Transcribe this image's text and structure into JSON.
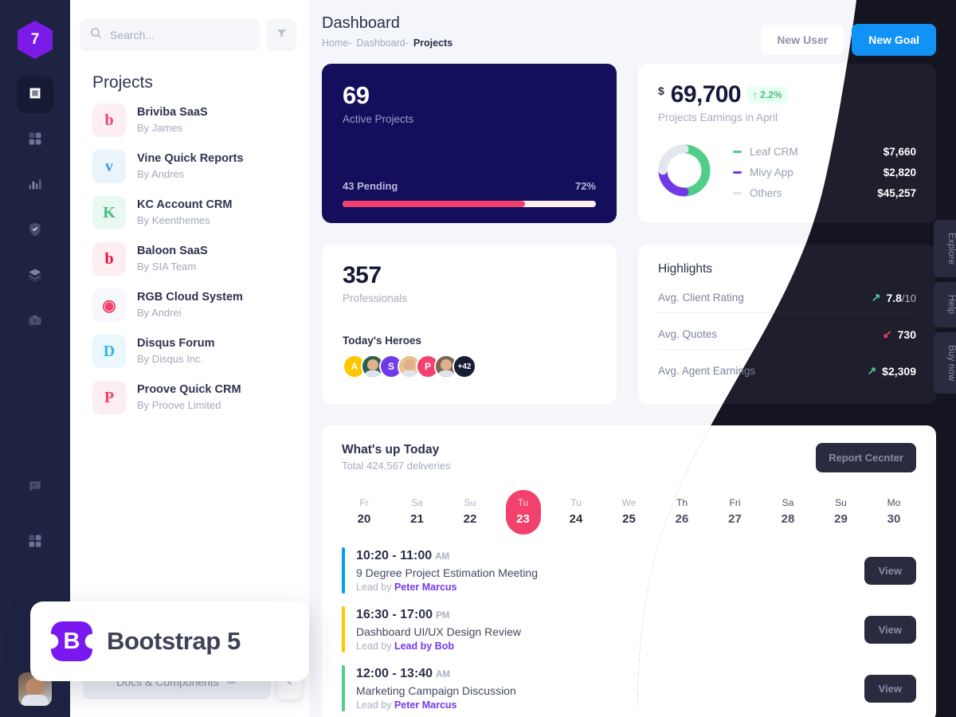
{
  "rail": {
    "logo_text": "7",
    "items": [
      {
        "name": "artboard-icon",
        "active": true
      },
      {
        "name": "grid-icon",
        "active": false
      },
      {
        "name": "bar-chart-icon",
        "active": false
      },
      {
        "name": "shield-check-icon",
        "active": false
      },
      {
        "name": "layers-icon",
        "active": false
      },
      {
        "name": "briefcase-icon",
        "active": false
      }
    ],
    "bottom_items": [
      {
        "name": "chat-icon"
      },
      {
        "name": "grid-icon"
      }
    ]
  },
  "search": {
    "placeholder": "Search...",
    "value": "",
    "icon": "search-icon",
    "filter_icon": "filter-icon"
  },
  "panel": {
    "title": "Projects",
    "docs_label": "Docs & Components",
    "projects": [
      {
        "name": "Briviba SaaS",
        "by": "By James",
        "glyph": "b",
        "color": "#f1416c",
        "bg": "#fdeef2"
      },
      {
        "name": "Vine Quick Reports",
        "by": "By Andres",
        "glyph": "v",
        "color": "#3b9ae1",
        "bg": "#eaf4fc"
      },
      {
        "name": "KC Account CRM",
        "by": "By Keenthemes",
        "glyph": "K",
        "color": "#47be7d",
        "bg": "#e9f8f0"
      },
      {
        "name": "Baloon SaaS",
        "by": "By SIA Team",
        "glyph": "b",
        "color": "#e8113c",
        "bg": "#fdeef2"
      },
      {
        "name": "RGB Cloud System",
        "by": "By Andrei",
        "glyph": "◉",
        "color": "#f1416c",
        "bg": "#f6f8fb"
      },
      {
        "name": "Disqus Forum",
        "by": "By Disqus Inc.",
        "glyph": "D",
        "color": "#2fb9e8",
        "bg": "#eaf7fd"
      },
      {
        "name": "Proove Quick CRM",
        "by": "By Proove Limited",
        "glyph": "P",
        "color": "#f1416c",
        "bg": "#fdeef2"
      }
    ]
  },
  "header": {
    "title": "Dashboard",
    "breadcrumb": [
      {
        "label": "Home-",
        "current": false
      },
      {
        "label": "Dashboard-",
        "current": false
      },
      {
        "label": "Projects",
        "current": true
      }
    ],
    "new_user_label": "New User",
    "new_goal_label": "New Goal"
  },
  "active_projects": {
    "count": "69",
    "label": "Active Projects",
    "pending": "43 Pending",
    "percent_label": "72%",
    "percent": 72,
    "bar_color": "#f1416c"
  },
  "earnings": {
    "currency": "$",
    "amount": "69,700",
    "delta": "2.2%",
    "delta_arrow": "↑",
    "subtitle": "Projects Earnings in April",
    "legend": [
      {
        "label": "Leaf CRM",
        "value": "$7,660",
        "color": "#50cd89"
      },
      {
        "label": "Mivy App",
        "value": "$2,820",
        "color": "#7239ea"
      },
      {
        "label": "Others",
        "value": "$45,257",
        "color": "#dfe2ea"
      }
    ],
    "donut": [
      {
        "name": "Leaf CRM",
        "pct": 50,
        "color": "#50cd89"
      },
      {
        "name": "Mivy App",
        "pct": 25,
        "color": "#7239ea"
      },
      {
        "name": "Others",
        "pct": 25,
        "color": "#e4e6ef"
      }
    ]
  },
  "professionals": {
    "count": "357",
    "label": "Professionals",
    "heroes_title": "Today's Heroes",
    "avatars": [
      {
        "initial": "A",
        "bg": "#ffc700",
        "photo": false
      },
      {
        "initial": "",
        "bg": "#2e5f4f",
        "photo": true
      },
      {
        "initial": "S",
        "bg": "#7239ea",
        "photo": false
      },
      {
        "initial": "",
        "bg": "#e8c38a",
        "photo": true
      },
      {
        "initial": "P",
        "bg": "#f1416c",
        "photo": false
      },
      {
        "initial": "",
        "bg": "#7b6558",
        "photo": true
      },
      {
        "initial": "+42",
        "bg": "#181c32",
        "photo": false
      }
    ]
  },
  "highlights": {
    "title": "Highlights",
    "rows": [
      {
        "label": "Avg. Client Rating",
        "arrow": "↗",
        "arrow_color": "#50cd89",
        "value": "7.8",
        "suffix": "/10"
      },
      {
        "label": "Avg. Quotes",
        "arrow": "↙",
        "arrow_color": "#f1416c",
        "value": "730",
        "suffix": ""
      },
      {
        "label": "Avg. Agent Earnings",
        "arrow": "↗",
        "arrow_color": "#50cd89",
        "value": "$2,309",
        "suffix": ""
      }
    ]
  },
  "whats_up": {
    "title": "What's up Today",
    "subtitle": "Total 424,567 deliveries",
    "button_label": "Report Cecnter",
    "days": [
      {
        "dow": "Fr",
        "num": "20",
        "selected": false,
        "dim": false
      },
      {
        "dow": "Sa",
        "num": "21",
        "selected": false,
        "dim": false
      },
      {
        "dow": "Su",
        "num": "22",
        "selected": false,
        "dim": false
      },
      {
        "dow": "Tu",
        "num": "23",
        "selected": true,
        "dim": false
      },
      {
        "dow": "Tu",
        "num": "24",
        "selected": false,
        "dim": false
      },
      {
        "dow": "We",
        "num": "25",
        "selected": false,
        "dim": false
      },
      {
        "dow": "Th",
        "num": "26",
        "selected": false,
        "dim": true
      },
      {
        "dow": "Fri",
        "num": "27",
        "selected": false,
        "dim": true
      },
      {
        "dow": "Sa",
        "num": "28",
        "selected": false,
        "dim": true
      },
      {
        "dow": "Su",
        "num": "29",
        "selected": false,
        "dim": true
      },
      {
        "dow": "Mo",
        "num": "30",
        "selected": false,
        "dim": true
      }
    ],
    "events": [
      {
        "time": "10:20 - 11:00",
        "meridiem": "AM",
        "title": "9 Degree Project Estimation Meeting",
        "lead_prefix": "Lead by ",
        "lead": "Peter Marcus",
        "color": "#009ef7",
        "view": "View"
      },
      {
        "time": "16:30 - 17:00",
        "meridiem": "PM",
        "title": "Dashboard UI/UX Design Review",
        "lead_prefix": "Lead by ",
        "lead": "Lead by Bob",
        "color": "#ffc700",
        "view": "View"
      },
      {
        "time": "12:00 - 13:40",
        "meridiem": "AM",
        "title": "Marketing Campaign Discussion",
        "lead_prefix": "Lead by ",
        "lead": "Peter Marcus",
        "color": "#50cd89",
        "view": "View"
      }
    ]
  },
  "side_tabs": [
    {
      "label": "Explore"
    },
    {
      "label": "Help"
    },
    {
      "label": "Buy now"
    }
  ],
  "toast": {
    "logo_letter": "B",
    "label": "Bootstrap 5",
    "color": "#7a18f0"
  },
  "colors": {
    "accent_blue": "#1193f5",
    "accent_pink": "#f1416c",
    "accent_purple": "#7239ea",
    "accent_green": "#50cd89",
    "dark_bg": "#151521",
    "dark_card": "#1e1e2d",
    "rail_bg": "#1e2342",
    "deep_navy": "#140f5c"
  }
}
